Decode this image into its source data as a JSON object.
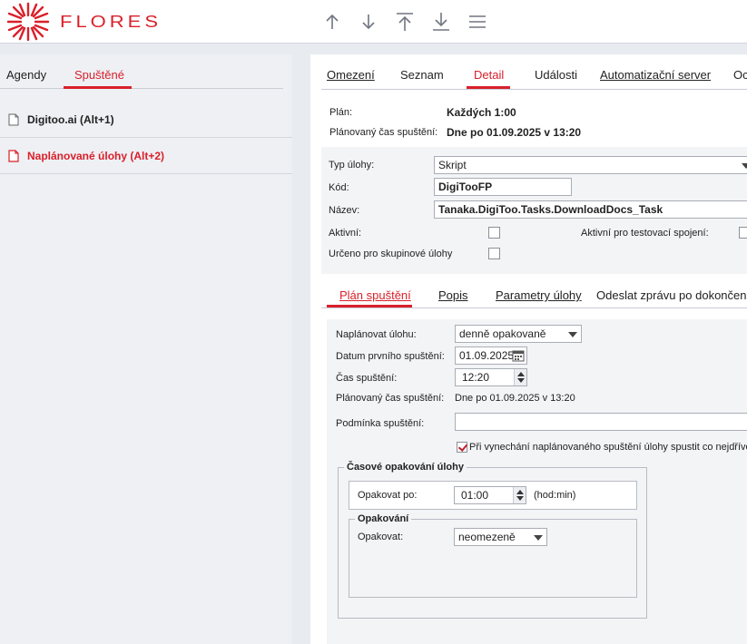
{
  "brand": {
    "name": "FLORES",
    "color": "#d9202a"
  },
  "toolbar": {
    "icons": [
      "arrow-up-icon",
      "arrow-down-icon",
      "arrow-to-top-icon",
      "arrow-to-bottom-icon",
      "menu-icon"
    ]
  },
  "left_panel": {
    "tabs": [
      {
        "label": "Agendy"
      },
      {
        "label": "Spuštěné"
      }
    ],
    "items": [
      {
        "label": "Digitoo.ai (Alt+1)"
      },
      {
        "label": "Naplánované úlohy (Alt+2)"
      }
    ]
  },
  "right_panel": {
    "tabs": [
      {
        "label": "Omezení"
      },
      {
        "label": "Seznam"
      },
      {
        "label": "Detail"
      },
      {
        "label": "Události"
      },
      {
        "label": "Automatizační server"
      },
      {
        "label": "Oc"
      }
    ],
    "info": {
      "plan_label": "Plán:",
      "plan_value": "Každých 1:00",
      "planned_label": "Plánovaný čas spuštění:",
      "planned_value": "Dne po 01.09.2025 v 13:20"
    },
    "form": {
      "type_label": "Typ úlohy:",
      "type_value": "Skript",
      "code_label": "Kód:",
      "code_value": "DigiTooFP",
      "name_label": "Název:",
      "name_value": "Tanaka.DigiToo.Tasks.DownloadDocs_Task",
      "active_label": "Aktivní:",
      "active_test_label": "Aktivní pro testovací spojení:",
      "group_label": "Určeno pro skupinové úlohy"
    },
    "sub_tabs": [
      {
        "label": "Plán spuštění"
      },
      {
        "label": "Popis"
      },
      {
        "label": "Parametry úlohy"
      },
      {
        "label": "Odeslat zprávu po dokončení"
      }
    ],
    "plan": {
      "schedule_label": "Naplánovat úlohu:",
      "schedule_value": "denně opakovaně",
      "first_date_label": "Datum prvního spuštění:",
      "first_date_value": "01.09.2025",
      "time_label": "Čas spuštění:",
      "time_value": "12:20",
      "planned_label": "Plánovaný čas spuštění:",
      "planned_value": "Dne po 01.09.2025 v 13:20",
      "condition_label": "Podmínka spuštění:",
      "condition_value": "",
      "skip_label": "Při vynechání naplánovaného spuštění úlohy spustit co nejdříve",
      "repeat_group_title": "Časové opakování úlohy",
      "repeat_every_label": "Opakovat po:",
      "repeat_every_value": "01:00",
      "repeat_unit": "(hod:min)",
      "repetition_group_title": "Opakování",
      "repeat_label": "Opakovat:",
      "repeat_value": "neomezeně"
    }
  }
}
